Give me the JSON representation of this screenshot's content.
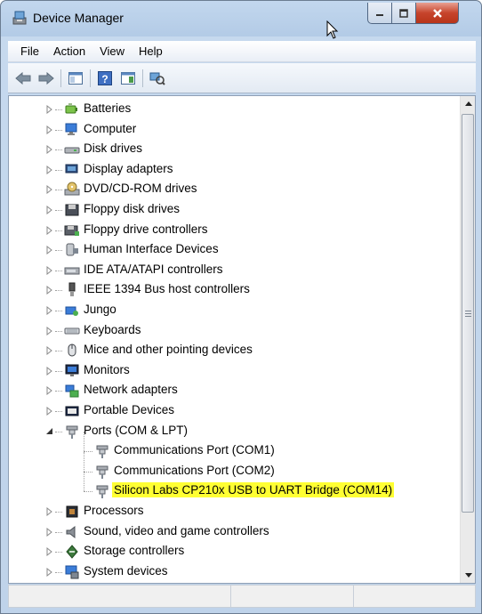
{
  "window": {
    "title": "Device Manager",
    "title_icon": "device-manager-icon",
    "controls": [
      "minimize",
      "maximize",
      "close"
    ]
  },
  "menubar": {
    "items": [
      "File",
      "Action",
      "View",
      "Help"
    ]
  },
  "toolbar": {
    "buttons": [
      "back-arrow-icon",
      "forward-arrow-icon",
      "show-hide-console-tree-icon",
      "help-icon",
      "properties-icon",
      "scan-hardware-icon"
    ]
  },
  "tree": {
    "items": [
      {
        "label": "Batteries",
        "icon": "battery-icon",
        "expanded": false
      },
      {
        "label": "Computer",
        "icon": "computer-icon",
        "expanded": false
      },
      {
        "label": "Disk drives",
        "icon": "disk-drive-icon",
        "expanded": false
      },
      {
        "label": "Display adapters",
        "icon": "display-adapter-icon",
        "expanded": false
      },
      {
        "label": "DVD/CD-ROM drives",
        "icon": "dvd-drive-icon",
        "expanded": false
      },
      {
        "label": "Floppy disk drives",
        "icon": "floppy-disk-icon",
        "expanded": false
      },
      {
        "label": "Floppy drive controllers",
        "icon": "floppy-controller-icon",
        "expanded": false
      },
      {
        "label": "Human Interface Devices",
        "icon": "hid-icon",
        "expanded": false
      },
      {
        "label": "IDE ATA/ATAPI controllers",
        "icon": "ide-controller-icon",
        "expanded": false
      },
      {
        "label": "IEEE 1394 Bus host controllers",
        "icon": "ieee1394-icon",
        "expanded": false
      },
      {
        "label": "Jungo",
        "icon": "jungo-icon",
        "expanded": false
      },
      {
        "label": "Keyboards",
        "icon": "keyboard-icon",
        "expanded": false
      },
      {
        "label": "Mice and other pointing devices",
        "icon": "mouse-icon",
        "expanded": false
      },
      {
        "label": "Monitors",
        "icon": "monitor-icon",
        "expanded": false
      },
      {
        "label": "Network adapters",
        "icon": "network-adapter-icon",
        "expanded": false
      },
      {
        "label": "Portable Devices",
        "icon": "portable-device-icon",
        "expanded": false
      },
      {
        "label": "Ports (COM & LPT)",
        "icon": "port-icon",
        "expanded": true
      },
      {
        "label": "Communications Port (COM1)",
        "icon": "port-icon",
        "child": true
      },
      {
        "label": "Communications Port (COM2)",
        "icon": "port-icon",
        "child": true
      },
      {
        "label": "Silicon Labs CP210x USB to UART Bridge (COM14)",
        "icon": "port-icon",
        "child": true,
        "highlighted": true
      },
      {
        "label": "Processors",
        "icon": "processor-icon",
        "expanded": false
      },
      {
        "label": "Sound, video and game controllers",
        "icon": "sound-icon",
        "expanded": false
      },
      {
        "label": "Storage controllers",
        "icon": "storage-controller-icon",
        "expanded": false
      },
      {
        "label": "System devices",
        "icon": "system-device-icon",
        "expanded": false
      }
    ]
  },
  "colors": {
    "highlight": "#ffff33",
    "window_frame": "#b9d1ea",
    "close_button": "#c7442c"
  }
}
